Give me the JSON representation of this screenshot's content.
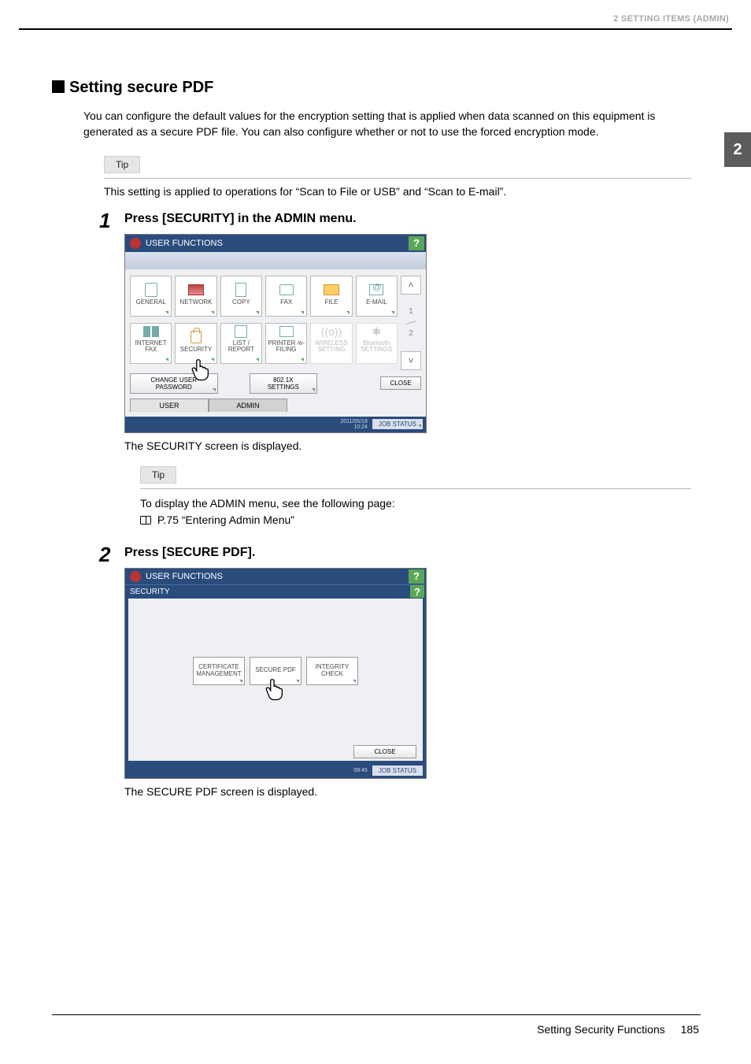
{
  "header_text": "2 SETTING ITEMS (ADMIN)",
  "side_tab": "2",
  "section_title": "Setting secure PDF",
  "intro": "You can configure the default values for the encryption setting that is applied when data scanned on this equipment is generated as a secure PDF file. You can also configure whether or not to use the forced encryption mode.",
  "tip_label": "Tip",
  "tip_text": "This setting is applied to operations for “Scan to File or USB” and “Scan to E-mail”.",
  "step1": {
    "num": "1",
    "title": "Press [SECURITY] in the ADMIN menu.",
    "after": "The SECURITY screen is displayed.",
    "tip2_text1": "To display the ADMIN menu, see the following page:",
    "tip2_text2": " P.75 “Entering Admin Menu”",
    "screen": {
      "title": "USER FUNCTIONS",
      "help": "?",
      "items_row1": [
        "GENERAL",
        "NETWORK",
        "COPY",
        "FAX",
        "FILE",
        "E-MAIL"
      ],
      "items_row2": [
        "INTERNET FAX",
        "SECURITY",
        "LIST / REPORT",
        "PRINTER /e-FILING",
        "WIRELESS SETTING",
        "Bluetooth SETTINGS"
      ],
      "disabled_r2_idx": [
        4,
        5
      ],
      "page1": "1",
      "page2": "2",
      "btn_change_pwd": "CHANGE USER PASSWORD",
      "btn_8021x": "802.1X SETTINGS",
      "btn_close": "CLOSE",
      "tab_user": "USER",
      "tab_admin": "ADMIN",
      "datetime1": "2011/05/18",
      "datetime2": "10:24",
      "jobstatus": "JOB STATUS"
    }
  },
  "step2": {
    "num": "2",
    "title": "Press [SECURE PDF].",
    "after": "The SECURE PDF screen is displayed.",
    "screen": {
      "title": "USER FUNCTIONS",
      "subtitle": "SECURITY",
      "help": "?",
      "items": [
        "CERTIFICATE MANAGEMENT",
        "SECURE PDF",
        "INTEGRITY CHECK"
      ],
      "btn_close": "CLOSE",
      "datetime": "09:45",
      "jobstatus": "JOB STATUS"
    }
  },
  "footer": {
    "text": "Setting Security Functions",
    "page": "185"
  }
}
